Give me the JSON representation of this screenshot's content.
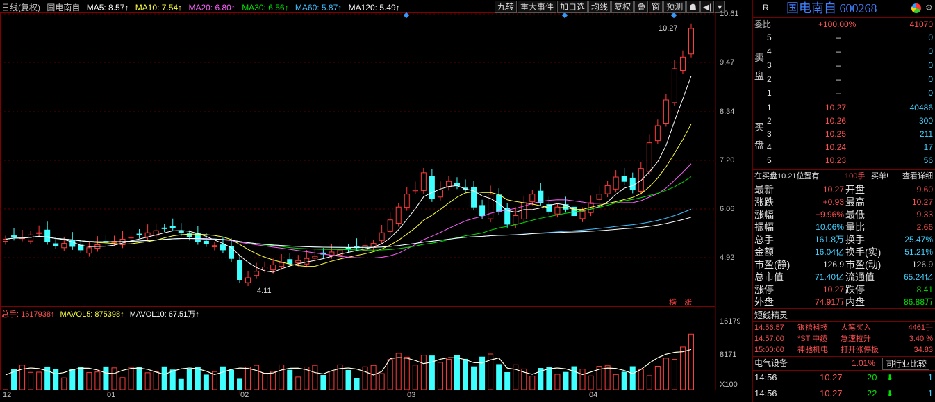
{
  "legend": {
    "kline_type": "日线(复权)",
    "name": "国电南自",
    "ma5": "MA5: 8.57↑",
    "ma10": "MA10: 7.54↑",
    "ma20": "MA20: 6.80↑",
    "ma30": "MA30: 6.56↑",
    "ma60": "MA60: 5.87↑",
    "ma120": "MA120: 5.49↑"
  },
  "toolbar": [
    "九转",
    "重大事件",
    "加自选",
    "均线",
    "复权",
    "叠",
    "窗",
    "预测"
  ],
  "price_axis": [
    "10.61",
    "9.47",
    "8.34",
    "7.20",
    "6.06",
    "4.92"
  ],
  "annotations": {
    "high": "10.27",
    "low": "4.11",
    "badge1": "榜",
    "badge2": "涨"
  },
  "volume": {
    "total": "总手: 1617938↑",
    "mavol5": "MAVOL5: 875398↑",
    "mavol10": "MAVOL10: 67.51万↑",
    "axis_top": "16179",
    "axis_mid": "8171",
    "axis_unit": "X100"
  },
  "months": [
    "12",
    "01",
    "02",
    "03",
    "04"
  ],
  "side": {
    "r_label": "R",
    "title": "国电南自 600268",
    "wb_label": "委比",
    "wb_value": "+100.00%",
    "wb_diff": "41070",
    "sell_label": [
      "卖",
      "盘"
    ],
    "sells": [
      {
        "n": "5",
        "price": "–",
        "vol": "0"
      },
      {
        "n": "4",
        "price": "–",
        "vol": "0"
      },
      {
        "n": "3",
        "price": "–",
        "vol": "0"
      },
      {
        "n": "2",
        "price": "–",
        "vol": "0"
      },
      {
        "n": "1",
        "price": "–",
        "vol": "0"
      }
    ],
    "buy_label": [
      "买",
      "盘"
    ],
    "buys": [
      {
        "n": "1",
        "price": "10.27",
        "vol": "40486"
      },
      {
        "n": "2",
        "price": "10.26",
        "vol": "300"
      },
      {
        "n": "3",
        "price": "10.25",
        "vol": "211"
      },
      {
        "n": "4",
        "price": "10.24",
        "vol": "17"
      },
      {
        "n": "5",
        "price": "10.23",
        "vol": "56"
      }
    ],
    "bid_note": "在买盘10.21位置有",
    "bid_note_qty": "100手",
    "bid_note_tail": "买单!",
    "detail_link": "查看详细",
    "stats": [
      {
        "l1": "最新",
        "v1": "10.27",
        "c1": "red",
        "l2": "开盘",
        "v2": "9.60",
        "c2": "red"
      },
      {
        "l1": "涨跌",
        "v1": "+0.93",
        "c1": "red",
        "l2": "最高",
        "v2": "10.27",
        "c2": "red"
      },
      {
        "l1": "涨幅",
        "v1": "+9.96%",
        "c1": "red",
        "l2": "最低",
        "v2": "9.33",
        "c2": "red"
      },
      {
        "l1": "振幅",
        "v1": "10.06%",
        "c1": "cyan",
        "l2": "量比",
        "v2": "2.66",
        "c2": "red"
      },
      {
        "l1": "总手",
        "v1": "161.8万",
        "c1": "cyan",
        "l2": "换手",
        "v2": "25.47%",
        "c2": "cyan"
      },
      {
        "l1": "金额",
        "v1": "16.04亿",
        "c1": "cyan",
        "l2": "换手(实)",
        "v2": "51.21%",
        "c2": "cyan"
      },
      {
        "l1": "市盈(静)",
        "v1": "126.9",
        "c1": "wh",
        "l2": "市盈(动)",
        "v2": "126.9",
        "c2": "wh"
      },
      {
        "l1": "总市值",
        "v1": "71.40亿",
        "c1": "cyan",
        "l2": "流通值",
        "v2": "65.24亿",
        "c2": "cyan"
      },
      {
        "l1": "涨停",
        "v1": "10.27",
        "c1": "red",
        "l2": "跌停",
        "v2": "8.41",
        "c2": "grn"
      },
      {
        "l1": "外盘",
        "v1": "74.91万",
        "c1": "red",
        "l2": "内盘",
        "v2": "86.88万",
        "c2": "grn"
      }
    ],
    "sprite_title": "短线精灵",
    "sprites": [
      {
        "time": "14:56:57",
        "name": "银禧科技",
        "event": "大笔买入",
        "val": "4461手"
      },
      {
        "time": "14:57:00",
        "name": "*ST 中缆",
        "event": "急速拉升",
        "val": "3.40 %"
      },
      {
        "time": "15:00:00",
        "name": "神驰机电",
        "event": "打开涨停板",
        "val": "34.83"
      }
    ],
    "sector": "电气设备",
    "sector_pct": "1.01%",
    "peer_button": "同行业比较",
    "ticks": [
      {
        "time": "14:56",
        "price": "10.27",
        "vol": "20",
        "n": "1"
      },
      {
        "time": "14:56",
        "price": "10.27",
        "vol": "22",
        "n": "1"
      }
    ]
  },
  "colors": {
    "up": "#ff3c3c",
    "down": "#40ffff",
    "ma5": "#ffffff",
    "ma10": "#ffff40",
    "ma20": "#ff60ff",
    "ma30": "#00e000",
    "ma60": "#40c0ff",
    "ma120": "#ffffff"
  }
}
